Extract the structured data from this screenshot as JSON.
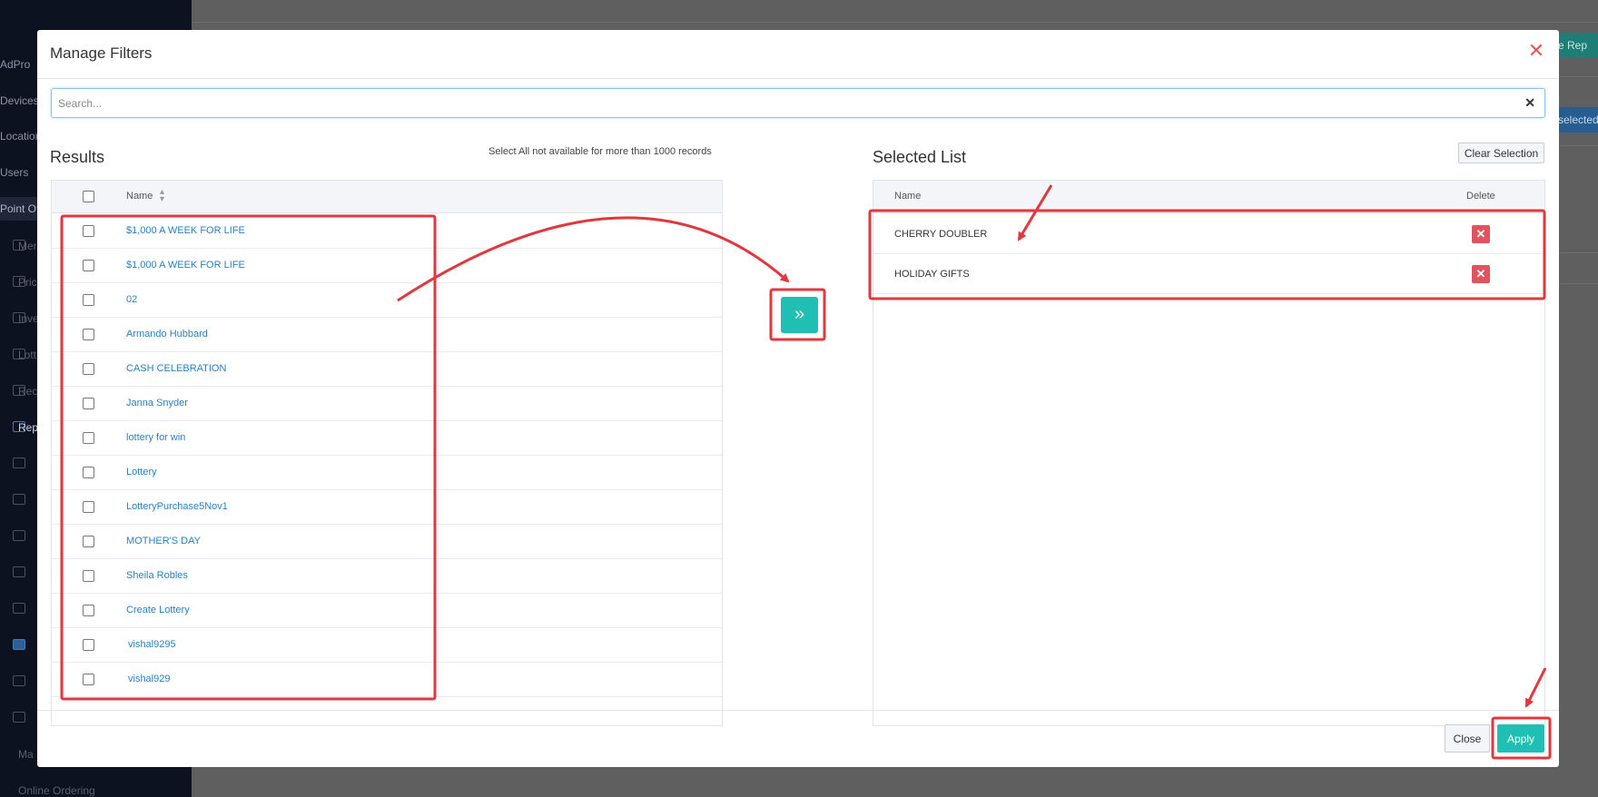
{
  "background": {
    "sidebar_items": [
      {
        "label": "AdPro"
      },
      {
        "label": "Devices"
      },
      {
        "label": "Locations"
      },
      {
        "label": "Users"
      },
      {
        "label": "Point Of"
      },
      {
        "label": "Mer"
      },
      {
        "label": "Pric"
      },
      {
        "label": "Inve"
      },
      {
        "label": "Lott"
      },
      {
        "label": "Rec"
      },
      {
        "label": "Rep"
      },
      {
        "label": "Ma"
      },
      {
        "label": "Online Ordering"
      }
    ],
    "green_button_label": "ate Rep",
    "blue_button_label": "selected"
  },
  "modal": {
    "title": "Manage Filters",
    "close_icon": "close-icon"
  },
  "search": {
    "placeholder": "Search...",
    "value": ""
  },
  "results": {
    "title": "Results",
    "select_all_note": "Select All not available for more than 1000 records",
    "column_name": "Name",
    "rows": [
      {
        "name": "$1,000 A WEEK FOR LIFE",
        "checked": false
      },
      {
        "name": "$1,000 A WEEK FOR LIFE",
        "checked": false
      },
      {
        "name": "02",
        "checked": false
      },
      {
        "name": "Armando Hubbard",
        "checked": false
      },
      {
        "name": "CASH CELEBRATION",
        "checked": false
      },
      {
        "name": "Janna Snyder",
        "checked": false
      },
      {
        "name": "lottery for win",
        "checked": false
      },
      {
        "name": "Lottery",
        "checked": false
      },
      {
        "name": "LotteryPurchase5Nov1",
        "checked": false
      },
      {
        "name": "MOTHER'S DAY",
        "checked": false
      },
      {
        "name": "Sheila Robles",
        "checked": false
      },
      {
        "name": "Create Lottery",
        "checked": false
      },
      {
        "name": "vishal9295",
        "checked": false
      },
      {
        "name": "vishal929",
        "checked": false
      }
    ]
  },
  "transfer_button": {
    "icon": "double-chevron-right-icon",
    "glyph": "»"
  },
  "selected": {
    "title": "Selected List",
    "clear_label": "Clear Selection",
    "column_name": "Name",
    "column_delete": "Delete",
    "rows": [
      {
        "name": "CHERRY DOUBLER"
      },
      {
        "name": "HOLIDAY GIFTS"
      }
    ]
  },
  "footer": {
    "close_label": "Close",
    "apply_label": "Apply"
  },
  "colors": {
    "accent": "#1fbfb3",
    "link": "#2a7fc1",
    "danger": "#e0545f",
    "annotation": "#e0383e"
  }
}
